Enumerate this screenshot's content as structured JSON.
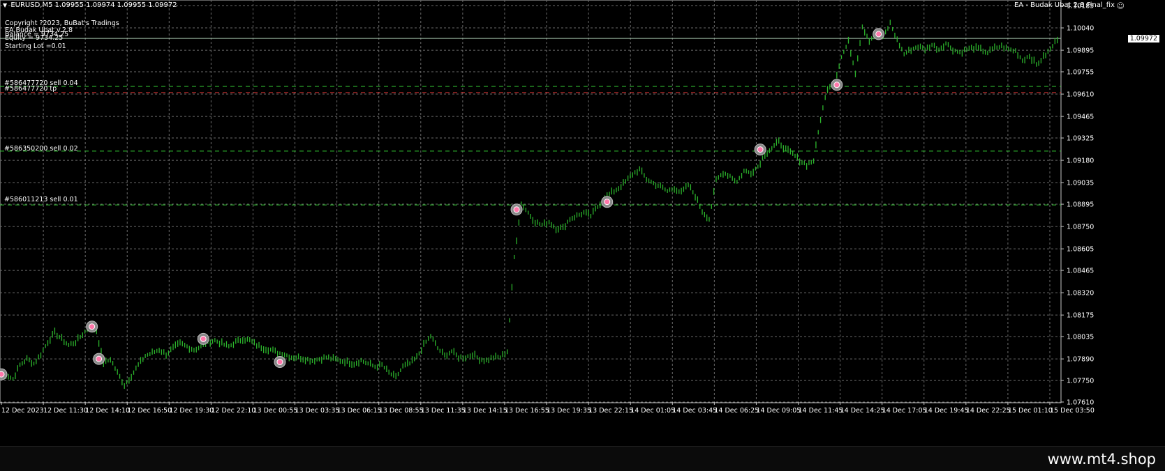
{
  "chart_header": {
    "symbol_line": "EURUSD,M5  1.09955 1.09974 1.09955 1.09972",
    "ea_name": "EA - Budak Ubat 2.8 Final_fix"
  },
  "info": {
    "copyright": "Copyright ?2023, BuBat's Tradings",
    "ea_version": "EA Budak Ubat v.2.8",
    "balance": "Balance = 9734.25",
    "equity": "Equity = 9734.25",
    "starting_lot": "Starting Lot =0.01"
  },
  "orders": [
    {
      "label": "#586477720 sell 0.04",
      "price": 1.0966,
      "color": "#33cc33"
    },
    {
      "label": "#586477720 tp",
      "price": 1.0962,
      "color": "#dd3333"
    },
    {
      "label": "#586350200 sell 0.02",
      "price": 1.0924,
      "color": "#33cc33"
    },
    {
      "label": "#586011213 sell 0.01",
      "price": 1.0889,
      "color": "#33cc33"
    }
  ],
  "current_price": "1.09972",
  "footer_url": "www.mt4.shop",
  "chart_data": {
    "type": "line",
    "title": "EURUSD,M5",
    "y_ticks": [
      "1.10185",
      "1.10040",
      "1.09895",
      "1.09755",
      "1.09610",
      "1.09465",
      "1.09325",
      "1.09180",
      "1.09035",
      "1.08895",
      "1.08750",
      "1.08605",
      "1.08465",
      "1.08320",
      "1.08175",
      "1.08035",
      "1.07890",
      "1.07750",
      "1.07610"
    ],
    "x_ticks": [
      "12 Dec 2023",
      "12 Dec 11:30",
      "12 Dec 14:10",
      "12 Dec 16:50",
      "12 Dec 19:30",
      "12 Dec 22:10",
      "13 Dec 00:55",
      "13 Dec 03:35",
      "13 Dec 06:15",
      "13 Dec 08:55",
      "13 Dec 11:35",
      "13 Dec 14:15",
      "13 Dec 16:55",
      "13 Dec 19:35",
      "13 Dec 22:15",
      "14 Dec 01:05",
      "14 Dec 03:45",
      "14 Dec 06:25",
      "14 Dec 09:05",
      "14 Dec 11:45",
      "14 Dec 14:25",
      "14 Dec 17:05",
      "14 Dec 19:45",
      "14 Dec 22:25",
      "15 Dec 01:10",
      "15 Dec 03:50"
    ],
    "ylim": [
      1.0761,
      1.10185
    ],
    "grid": true,
    "series": [
      {
        "values": [
          1.0779,
          1.0776,
          1.0785,
          1.0789,
          1.0786,
          1.0792,
          1.08,
          1.0806,
          1.0802,
          1.0798,
          1.08,
          1.0805,
          1.081,
          1.0807,
          1.0786,
          1.0789,
          1.078,
          1.0772,
          1.0778,
          1.0785,
          1.0791,
          1.0793,
          1.0795,
          1.0792,
          1.0796,
          1.0799,
          1.0797,
          1.0795,
          1.0797,
          1.08,
          1.0801,
          1.0799,
          1.0797,
          1.08,
          1.0802,
          1.0801,
          1.0798,
          1.0796,
          1.0795,
          1.0793,
          1.0792,
          1.079,
          1.079,
          1.0789,
          1.0788,
          1.0789,
          1.079,
          1.0789,
          1.0788,
          1.0787,
          1.0786,
          1.0788,
          1.0786,
          1.0784,
          1.0785,
          1.078,
          1.0777,
          1.0784,
          1.0786,
          1.079,
          1.0798,
          1.0804,
          1.0796,
          1.0791,
          1.0794,
          1.079,
          1.079,
          1.0792,
          1.0789,
          1.0788,
          1.079,
          1.079,
          1.0794,
          1.0855,
          1.089,
          1.0884,
          1.0878,
          1.0876,
          1.0878,
          1.0874,
          1.0874,
          1.088,
          1.0882,
          1.0884,
          1.0882,
          1.0888,
          1.0894,
          1.0897,
          1.09,
          1.0904,
          1.0909,
          1.0912,
          1.0906,
          1.0903,
          1.0901,
          1.0898,
          1.09,
          1.0897,
          1.0902,
          1.0895,
          1.0885,
          1.088,
          1.0905,
          1.091,
          1.0908,
          1.0904,
          1.0911,
          1.091,
          1.0914,
          1.0922,
          1.0926,
          1.093,
          1.0925,
          1.0922,
          1.0918,
          1.0915,
          1.0918,
          1.0945,
          1.0965,
          1.0969,
          1.0985,
          1.0995,
          1.0975,
          1.1005,
          1.0996,
          1.1,
          1.0998,
          1.1007,
          1.0996,
          1.0987,
          1.099,
          1.0992,
          1.099,
          1.0993,
          1.099,
          1.0994,
          1.099,
          1.0988,
          1.099,
          1.0991,
          1.099,
          1.0988,
          1.0991,
          1.0992,
          1.099,
          1.0989,
          1.0983,
          1.0986,
          1.098,
          1.0985,
          1.099,
          1.0997
        ]
      }
    ]
  }
}
